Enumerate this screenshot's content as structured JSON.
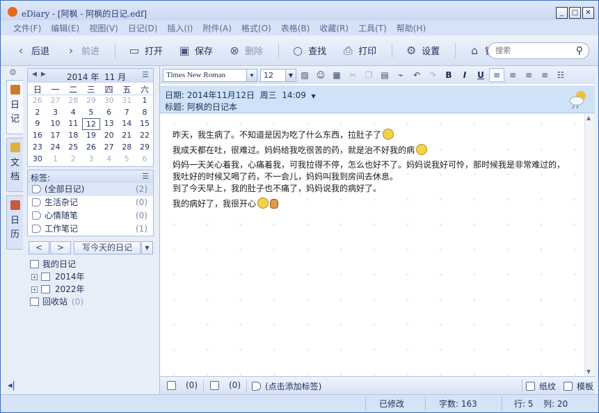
{
  "window": {
    "title": "eDiary - [阿枫 - 阿枫的日记.edf]"
  },
  "menu": [
    "文件(F)",
    "编辑(E)",
    "视图(V)",
    "日记(D)",
    "插入(I)",
    "附件(A)",
    "格式(O)",
    "表格(B)",
    "收藏(R)",
    "工具(T)",
    "帮助(H)"
  ],
  "toolbar": {
    "back": "后退",
    "forward": "前进",
    "open": "打开",
    "save": "保存",
    "delete": "删除",
    "find": "查找",
    "print": "打印",
    "settings": "设置",
    "lock": "锁定",
    "search_placeholder": "搜索"
  },
  "vtabs": [
    [
      "日",
      "记"
    ],
    [
      "文",
      "档"
    ],
    [
      "日",
      "历"
    ]
  ],
  "calendar": {
    "year": "2014",
    "year_label": "年",
    "month": "11",
    "month_label": "月",
    "weekdays": [
      "日",
      "一",
      "二",
      "三",
      "四",
      "五",
      "六"
    ],
    "days": [
      [
        "26",
        "o"
      ],
      [
        "27",
        "o"
      ],
      [
        "28",
        "o"
      ],
      [
        "29",
        "o"
      ],
      [
        "30",
        "o"
      ],
      [
        "31",
        "o"
      ],
      [
        "1",
        ""
      ],
      [
        "2",
        ""
      ],
      [
        "3",
        ""
      ],
      [
        "4",
        ""
      ],
      [
        "5",
        ""
      ],
      [
        "6",
        ""
      ],
      [
        "7",
        ""
      ],
      [
        "8",
        ""
      ],
      [
        "9",
        ""
      ],
      [
        "10",
        ""
      ],
      [
        "11",
        ""
      ],
      [
        "12",
        "today"
      ],
      [
        "13",
        ""
      ],
      [
        "14",
        ""
      ],
      [
        "15",
        ""
      ],
      [
        "16",
        ""
      ],
      [
        "17",
        ""
      ],
      [
        "18",
        ""
      ],
      [
        "19",
        ""
      ],
      [
        "20",
        ""
      ],
      [
        "21",
        ""
      ],
      [
        "22",
        ""
      ],
      [
        "23",
        ""
      ],
      [
        "24",
        ""
      ],
      [
        "25",
        ""
      ],
      [
        "26",
        ""
      ],
      [
        "27",
        ""
      ],
      [
        "28",
        ""
      ],
      [
        "29",
        ""
      ],
      [
        "30",
        ""
      ],
      [
        "1",
        "o"
      ],
      [
        "2",
        "o"
      ],
      [
        "3",
        "o"
      ],
      [
        "4",
        "o"
      ],
      [
        "5",
        "o"
      ],
      [
        "6",
        "o"
      ]
    ]
  },
  "tags": {
    "header": "标签:",
    "items": [
      {
        "label": "(全部日记)",
        "count": "(2)"
      },
      {
        "label": "生活杂记",
        "count": "(0)"
      },
      {
        "label": "心情随笔",
        "count": "(0)"
      },
      {
        "label": "工作笔记",
        "count": "(1)"
      }
    ]
  },
  "nav": {
    "prev": "<",
    "next": ">",
    "write_today": "写今天的日记"
  },
  "tree": {
    "root": "我的日记",
    "years": [
      "2014年",
      "2022年"
    ],
    "recycle": "回收站",
    "recycle_count": "(0)"
  },
  "format": {
    "font": "Times New Roman",
    "size": "12"
  },
  "entry": {
    "date_label": "日期:",
    "date": "2014年11月12日",
    "weekday": "周三",
    "time": "14:09",
    "title_label": "标题:",
    "title": "阿枫的日记本",
    "lines": [
      "昨天，我生病了。不知道是因为吃了什么东西，拉肚子了",
      "我成天都在吐，很难过。妈妈给我吃很苦的药，就是治不好我的病",
      "妈妈一天关心着我，心痛着我，可我拉得不停，怎么也好不了。妈妈说我好可怜，那时候我是非常难过的，",
      "我吐好的时候又喝了药，不一会儿，妈妈叫我到房间去休息。",
      "到了今天早上，我的肚子也不痛了，妈妈说我的病好了。",
      "我的病好了，我很开心"
    ]
  },
  "bottom": {
    "attach_count": "(0)",
    "comment_count": "(0)",
    "add_tag": "(点击添加标签)",
    "paper": "纸纹",
    "template": "模板"
  },
  "status": {
    "modified": "已修改",
    "chars_label": "字数:",
    "chars": "163",
    "line_label": "行:",
    "line": "5",
    "col_label": "列:",
    "col": "20"
  }
}
